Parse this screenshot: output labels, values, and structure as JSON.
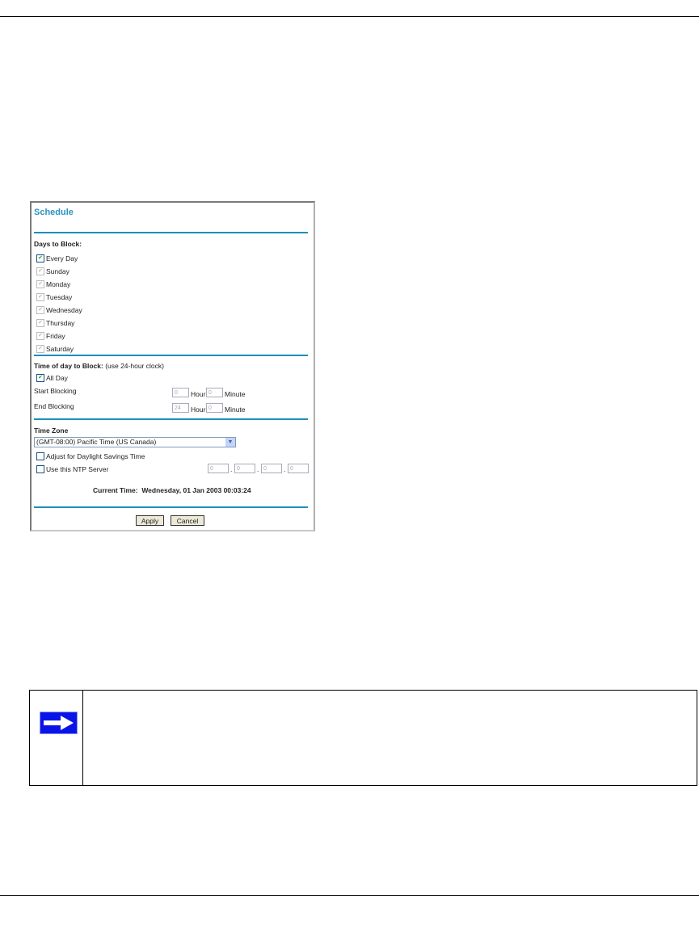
{
  "schedule": {
    "title": "Schedule",
    "days_heading": "Days to Block:",
    "days": [
      {
        "label": "Every Day",
        "checked": true
      },
      {
        "label": "Sunday"
      },
      {
        "label": "Monday"
      },
      {
        "label": "Tuesday"
      },
      {
        "label": "Wednesday"
      },
      {
        "label": "Thursday"
      },
      {
        "label": "Friday"
      },
      {
        "label": "Saturday"
      }
    ],
    "time_heading": "Time of day to Block:",
    "time_hint": "(use 24-hour clock)",
    "all_day": "All Day",
    "start_label": "Start Blocking",
    "end_label": "End Blocking",
    "start_hour": "0",
    "start_minute": "0",
    "end_hour": "24",
    "end_minute": "0",
    "hour_label": "Hour",
    "minute_label": "Minute",
    "tz_heading": "Time Zone",
    "tz_value": "(GMT-08:00) Pacific Time (US Canada)",
    "dst_label": "Adjust for Daylight Savings Time",
    "ntp_label": "Use this NTP Server",
    "ntp": [
      "0",
      "0",
      "0",
      "0"
    ],
    "current_time_label": "Current Time:",
    "current_time": "Wednesday, 01 Jan 2003 00:03:24",
    "apply": "Apply",
    "cancel": "Cancel"
  },
  "note_icon": "arrow-right-icon"
}
